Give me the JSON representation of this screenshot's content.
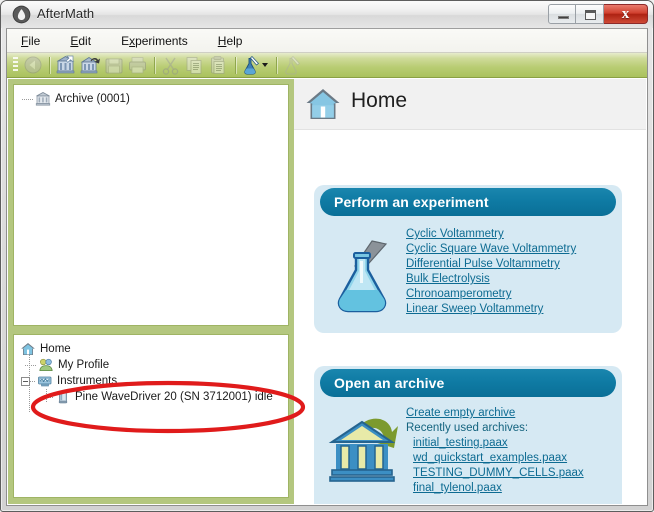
{
  "window": {
    "title": "AfterMath",
    "logo_icon": "aftermath-logo-icon",
    "buttons": {
      "minimize": "minimize-button",
      "maximize": "maximize-button",
      "close_label": "x"
    }
  },
  "menubar": {
    "items": [
      {
        "label": "File",
        "mnemonic_index": 0
      },
      {
        "label": "Edit",
        "mnemonic_index": 0
      },
      {
        "label": "Experiments",
        "mnemonic_index": 1
      },
      {
        "label": "Help",
        "mnemonic_index": 0
      }
    ]
  },
  "toolbar": {
    "items": [
      {
        "name": "back-icon",
        "enabled": false
      },
      {
        "name": "new-archive-icon",
        "enabled": true
      },
      {
        "name": "open-archive-icon",
        "enabled": true
      },
      {
        "name": "save-icon",
        "enabled": false
      },
      {
        "name": "print-icon",
        "enabled": false
      },
      {
        "name": "cut-icon",
        "enabled": false
      },
      {
        "name": "copy-icon",
        "enabled": false
      },
      {
        "name": "paste-icon",
        "enabled": false
      },
      {
        "name": "new-experiment-icon",
        "enabled": true
      },
      {
        "name": "run-experiment-icon",
        "enabled": false
      }
    ]
  },
  "archive_tree": {
    "nodes": [
      {
        "label": "Archive (0001)",
        "icon": "archive-bank-icon"
      }
    ]
  },
  "home_tree": {
    "nodes": [
      {
        "label": "Home",
        "icon": "home-icon",
        "depth": 0
      },
      {
        "label": "My Profile",
        "icon": "profile-icon",
        "depth": 1
      },
      {
        "label": "Instruments",
        "icon": "instruments-icon",
        "depth": 1
      },
      {
        "label": "Pine WaveDriver 20 (SN 3712001) idle",
        "icon": "instrument-device-icon",
        "depth": 2
      }
    ]
  },
  "page": {
    "title": "Home",
    "icon": "home-house-icon"
  },
  "perform_card": {
    "title": "Perform an experiment",
    "icon": "flask-icon",
    "links": [
      "Cyclic Voltammetry ",
      "Cyclic Square Wave Voltammetry ",
      "Differential Pulse Voltammetry ",
      "Bulk Electrolysis ",
      "Chronoamperometry ",
      "Linear Sweep Voltammetry "
    ]
  },
  "archive_card": {
    "title": "Open an archive",
    "icon": "bank-archive-icon",
    "create_link": "Create empty archive",
    "recent_heading": "Recently used archives:",
    "recent_files": [
      "initial_testing.paax",
      "wd_quickstart_examples.paax",
      "TESTING_DUMMY_CELLS.paax",
      "final_tylenol.paax"
    ]
  },
  "annotation": {
    "type": "red-ellipse-highlight",
    "color": "#e01b1b",
    "targets": "Pine WaveDriver 20 (SN 3712001) idle"
  },
  "colors": {
    "toolbar_green": "#aac25e",
    "panel_green": "#b4c77f",
    "card_blue": "#d6e9f3",
    "card_header_blue": "#0f7ba4",
    "link_blue": "#0d6b92",
    "annotation_red": "#e01b1b"
  }
}
